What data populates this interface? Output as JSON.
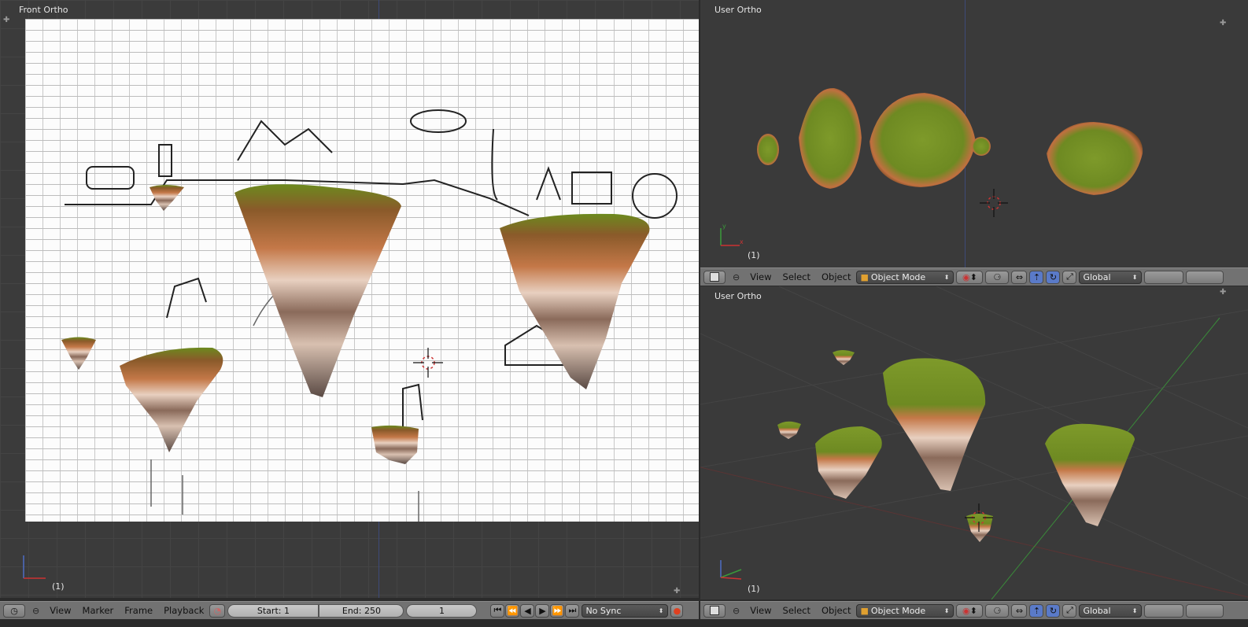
{
  "viewports": {
    "left": {
      "label": "Front Ortho",
      "frame": "(1)"
    },
    "top_right": {
      "label": "User Ortho",
      "frame": "(1)"
    },
    "bottom_right": {
      "label": "User Ortho",
      "frame": "(1)"
    }
  },
  "header_menu": {
    "view": "View",
    "select": "Select",
    "object": "Object"
  },
  "mode_dropdown": "Object Mode",
  "orientation_dropdown": "Global",
  "timeline": {
    "view": "View",
    "marker": "Marker",
    "frame": "Frame",
    "playback": "Playback",
    "start": "Start: 1",
    "end": "End: 250",
    "current": "1",
    "sync": "No Sync"
  },
  "axis": {
    "y": "y",
    "x": "x"
  },
  "colors": {
    "accent_blue": "#4e6cc4",
    "axis_green": "#3a9a3a",
    "axis_red": "#9a3a3a"
  }
}
